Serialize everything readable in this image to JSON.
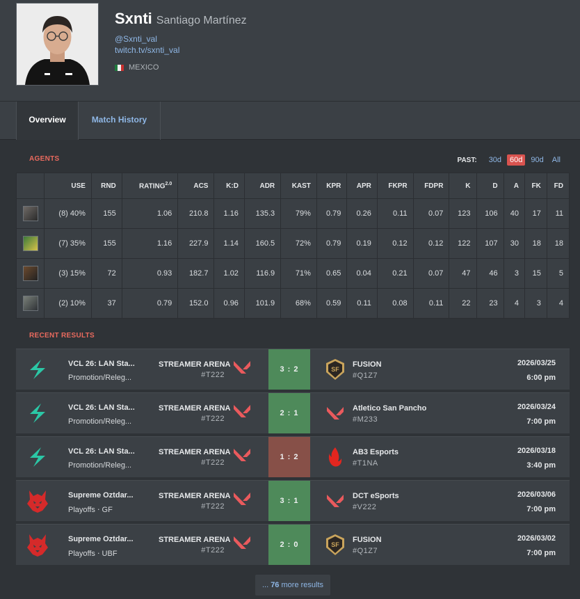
{
  "profile": {
    "handle": "Sxnti",
    "real_name": "Santiago Martínez",
    "twitter": "@Sxnti_val",
    "twitch": "twitch.tv/sxnti_val",
    "country": "MEXICO"
  },
  "tabs": {
    "overview": "Overview",
    "match_history": "Match History"
  },
  "agents_section": {
    "label": "AGENTS",
    "past_label": "PAST:",
    "past_options": [
      "30d",
      "60d",
      "90d",
      "All"
    ],
    "selected_period": "60d",
    "columns": [
      "USE",
      "RND",
      "RATING",
      "ACS",
      "K:D",
      "ADR",
      "KAST",
      "KPR",
      "APR",
      "FKPR",
      "FDPR",
      "K",
      "D",
      "A",
      "FK",
      "FD"
    ],
    "rating_sup": "2.0",
    "rows": [
      [
        "(8) 40%",
        "155",
        "1.06",
        "210.8",
        "1.16",
        "135.3",
        "79%",
        "0.79",
        "0.26",
        "0.11",
        "0.07",
        "123",
        "106",
        "40",
        "17",
        "11"
      ],
      [
        "(7) 35%",
        "155",
        "1.16",
        "227.9",
        "1.14",
        "160.5",
        "72%",
        "0.79",
        "0.19",
        "0.12",
        "0.12",
        "122",
        "107",
        "30",
        "18",
        "18"
      ],
      [
        "(3) 15%",
        "72",
        "0.93",
        "182.7",
        "1.02",
        "116.9",
        "71%",
        "0.65",
        "0.04",
        "0.21",
        "0.07",
        "47",
        "46",
        "3",
        "15",
        "5"
      ],
      [
        "(2) 10%",
        "37",
        "0.79",
        "152.0",
        "0.96",
        "101.9",
        "68%",
        "0.59",
        "0.11",
        "0.08",
        "0.11",
        "22",
        "23",
        "4",
        "3",
        "4"
      ]
    ]
  },
  "results_section": {
    "label": "RECENT RESULTS",
    "matches": [
      {
        "event": "VCL 26: LAN Sta...",
        "stage": "Promotion/Releg...",
        "team1": "STREAMER ARENA",
        "team1_tag": "#T222",
        "score": "3 : 2",
        "result": "win",
        "team2": "FUSION",
        "team2_tag": "#Q1Z7",
        "date": "2026/03/25",
        "time": "6:00 pm",
        "event_logo": "bolt",
        "team2_logo": "fusion"
      },
      {
        "event": "VCL 26: LAN Sta...",
        "stage": "Promotion/Releg...",
        "team1": "STREAMER ARENA",
        "team1_tag": "#T222",
        "score": "2 : 1",
        "result": "win",
        "team2": "Atletico San Pancho",
        "team2_tag": "#M233",
        "date": "2026/03/24",
        "time": "7:00 pm",
        "event_logo": "bolt",
        "team2_logo": "valorant"
      },
      {
        "event": "VCL 26: LAN Sta...",
        "stage": "Promotion/Releg...",
        "team1": "STREAMER ARENA",
        "team1_tag": "#T222",
        "score": "1 : 2",
        "result": "loss",
        "team2": "AB3 Esports",
        "team2_tag": "#T1NA",
        "date": "2026/03/18",
        "time": "3:40 pm",
        "event_logo": "bolt",
        "team2_logo": "flame"
      },
      {
        "event": "Supreme Oztdar...",
        "stage": "Playoffs ‧ GF",
        "team1": "STREAMER ARENA",
        "team1_tag": "#T222",
        "score": "3 : 1",
        "result": "win",
        "team2": "DCT eSports",
        "team2_tag": "#V222",
        "date": "2026/03/06",
        "time": "7:00 pm",
        "event_logo": "wolf",
        "team2_logo": "valorant"
      },
      {
        "event": "Supreme Oztdar...",
        "stage": "Playoffs ‧ UBF",
        "team1": "STREAMER ARENA",
        "team1_tag": "#T222",
        "score": "2 : 0",
        "result": "win",
        "team2": "FUSION",
        "team2_tag": "#Q1Z7",
        "date": "2026/03/02",
        "time": "7:00 pm",
        "event_logo": "wolf",
        "team2_logo": "fusion"
      }
    ],
    "more_prefix": "...",
    "more_count": "76",
    "more_suffix": "more results"
  },
  "colors": {
    "accent": "#ea6a5e",
    "link": "#8fb7e6",
    "win": "#4e8a5a",
    "loss": "#875048"
  }
}
